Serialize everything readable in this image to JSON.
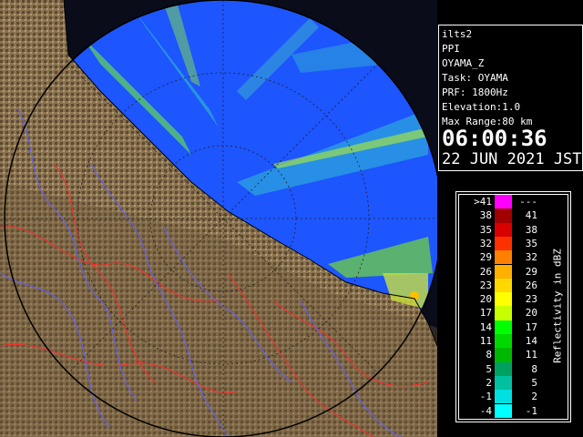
{
  "radar_display": {
    "station_id": "ilts2",
    "product": "PPI",
    "variable": "OYAMA_Z",
    "task": "Task: OYAMA",
    "prf": "PRF: 1800Hz",
    "elevation": "Elevation:1.0",
    "max_range": "Max Range:80 km",
    "time": "06:00:36",
    "date": "22 JUN 2021 JST"
  },
  "legend": {
    "title": "Reflectivity in dBZ",
    "rows": [
      {
        "lo": ">41",
        "hi": "---",
        "color": "#ff00ff"
      },
      {
        "lo": "38",
        "hi": "41",
        "color": "#a00000"
      },
      {
        "lo": "35",
        "hi": "38",
        "color": "#d80000"
      },
      {
        "lo": "32",
        "hi": "35",
        "color": "#ff3000"
      },
      {
        "lo": "29",
        "hi": "32",
        "color": "#ff8000"
      },
      {
        "lo": "26",
        "hi": "29",
        "color": "#ffb000"
      },
      {
        "lo": "23",
        "hi": "26",
        "color": "#ffd800"
      },
      {
        "lo": "20",
        "hi": "23",
        "color": "#ffff00"
      },
      {
        "lo": "17",
        "hi": "20",
        "color": "#c8ff00"
      },
      {
        "lo": "14",
        "hi": "17",
        "color": "#00ff00"
      },
      {
        "lo": "11",
        "hi": "14",
        "color": "#00d800"
      },
      {
        "lo": "8",
        "hi": "11",
        "color": "#00b800"
      },
      {
        "lo": "5",
        "hi": "8",
        "color": "#00a060"
      },
      {
        "lo": "2",
        "hi": "5",
        "color": "#00c0a0"
      },
      {
        "lo": "-1",
        "hi": "2",
        "color": "#00e0e0"
      },
      {
        "lo": "-4",
        "hi": "-1",
        "color": "#00ffff"
      }
    ]
  },
  "map_colors": {
    "sea": "#2266ff",
    "land": "#7a6444",
    "rivers": "#6a6aff",
    "boundaries": "#ff2020"
  }
}
